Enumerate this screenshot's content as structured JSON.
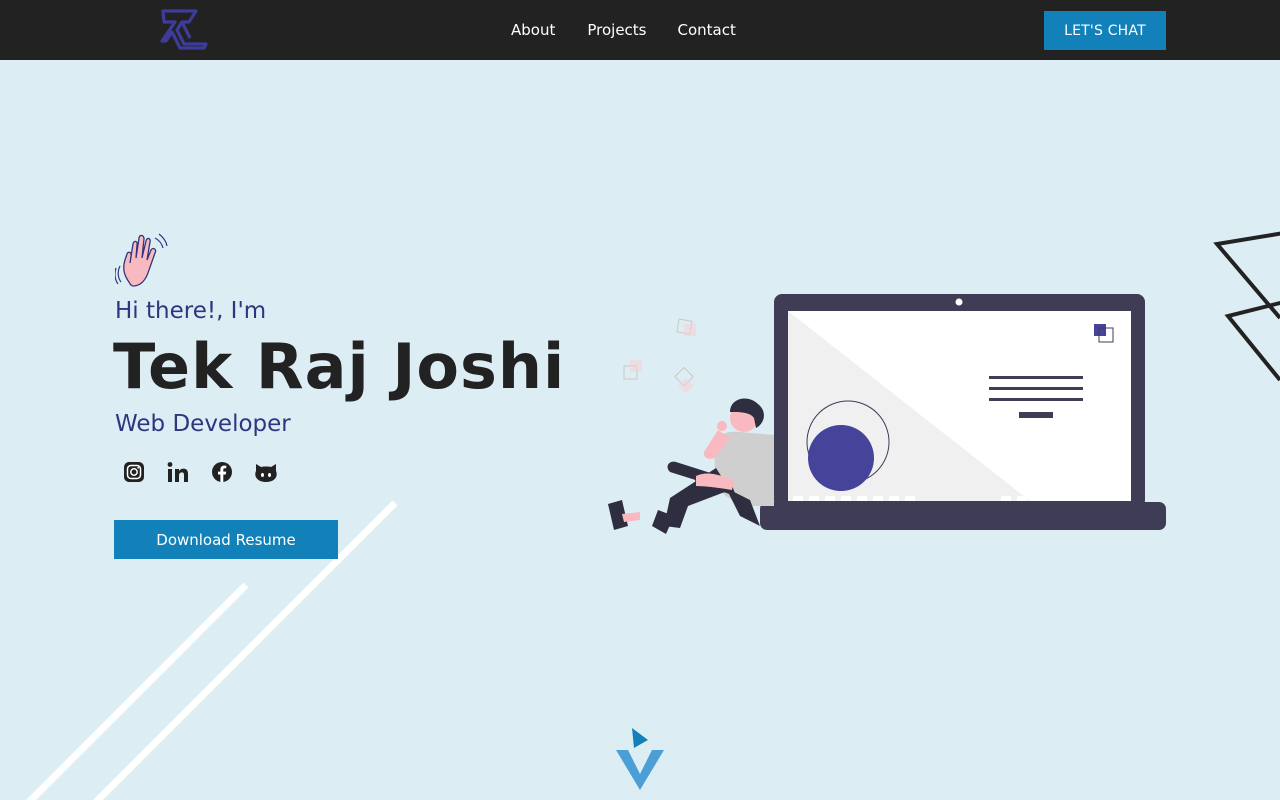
{
  "nav": {
    "logo_alt": "TK logo",
    "links": [
      {
        "label": "About"
      },
      {
        "label": "Projects"
      },
      {
        "label": "Contact"
      }
    ],
    "cta_label": "LET'S CHAT"
  },
  "hero": {
    "greeting": "Hi there!, I'm",
    "name": "Tek Raj Joshi",
    "role": "Web Developer",
    "socials": [
      {
        "icon": "instagram-icon"
      },
      {
        "icon": "linkedin-icon"
      },
      {
        "icon": "facebook-icon"
      },
      {
        "icon": "github-icon"
      }
    ],
    "resume_label": "Download Resume"
  },
  "colors": {
    "background": "#ddedf4",
    "navbar": "#222222",
    "accent": "#1281b9",
    "heading_blue": "#2f357e",
    "illustration_purple": "#3f3d56",
    "illustration_indigo": "#46439a"
  }
}
